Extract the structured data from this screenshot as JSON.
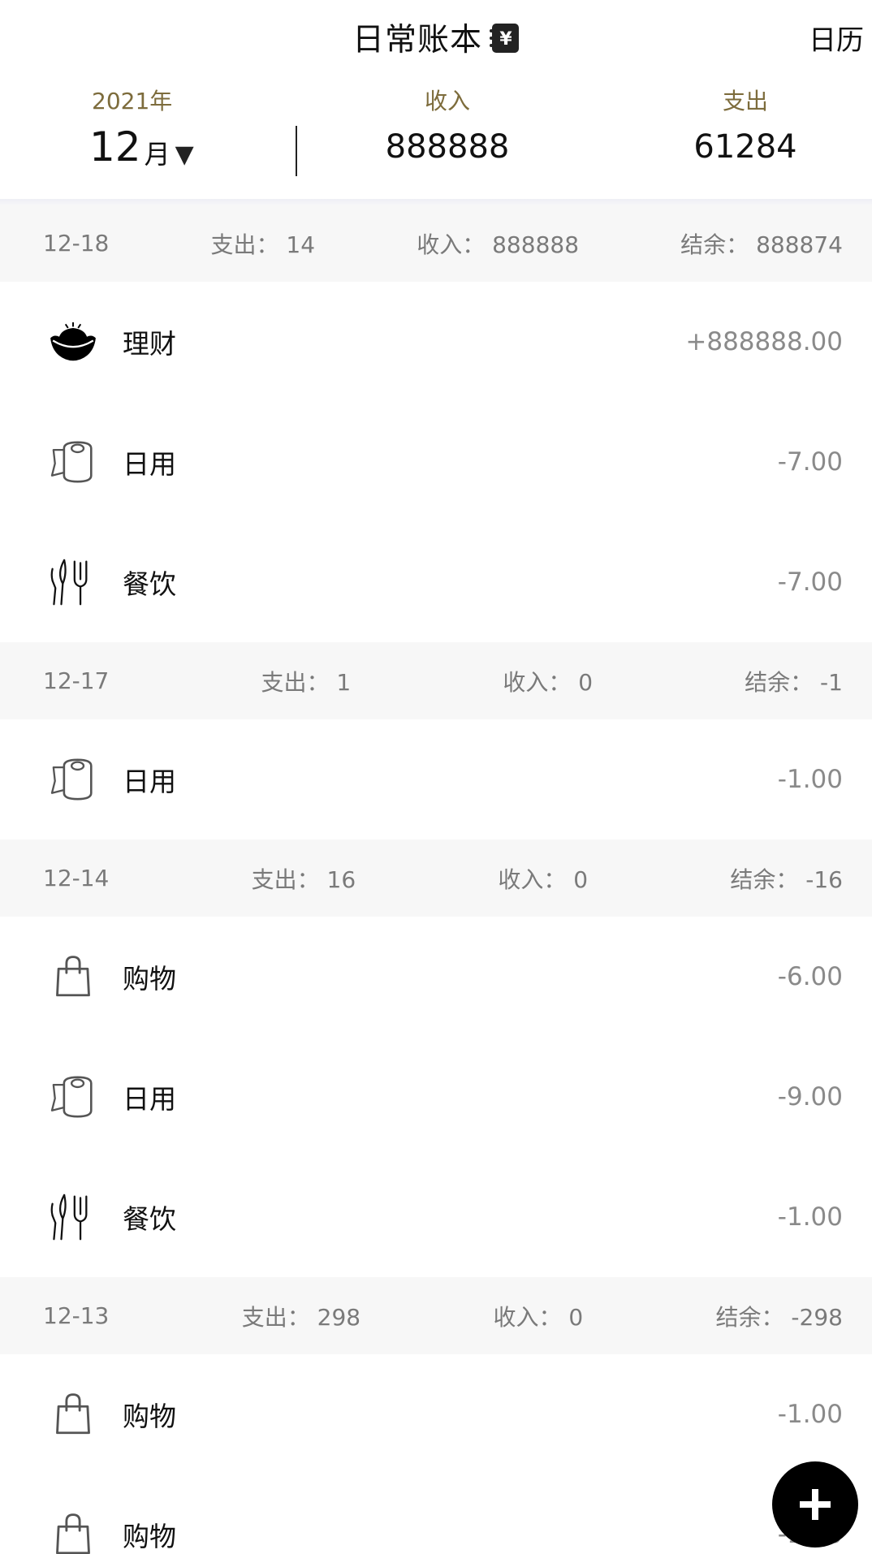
{
  "header": {
    "title": "日常账本",
    "title_icon": "yen-notebook-icon",
    "calendar_label": "日历"
  },
  "summary": {
    "year_label": "2021年",
    "month_value": "12",
    "month_unit": "月",
    "month_caret": "▼",
    "income_label": "收入",
    "income_value": "888888",
    "expense_label": "支出",
    "expense_value": "61284"
  },
  "colors": {
    "accent_gold": "#7d6c3c",
    "day_header_bg": "#f7f7f7",
    "amount_gray": "#8a8a8a",
    "fab": "#000000"
  },
  "days": [
    {
      "date": "12-18",
      "expense": "支出： 14",
      "income": "收入： 888888",
      "balance": "结余： 888874",
      "items": [
        {
          "category": "理财",
          "icon": "gold-ingot-icon",
          "amount": "+888888.00"
        },
        {
          "category": "日用",
          "icon": "toilet-paper-icon",
          "amount": "-7.00"
        },
        {
          "category": "餐饮",
          "icon": "cutlery-icon",
          "amount": "-7.00"
        }
      ]
    },
    {
      "date": "12-17",
      "expense": "支出： 1",
      "income": "收入： 0",
      "balance": "结余： -1",
      "items": [
        {
          "category": "日用",
          "icon": "toilet-paper-icon",
          "amount": "-1.00"
        }
      ]
    },
    {
      "date": "12-14",
      "expense": "支出： 16",
      "income": "收入： 0",
      "balance": "结余： -16",
      "items": [
        {
          "category": "购物",
          "icon": "shopping-bag-icon",
          "amount": "-6.00"
        },
        {
          "category": "日用",
          "icon": "toilet-paper-icon",
          "amount": "-9.00"
        },
        {
          "category": "餐饮",
          "icon": "cutlery-icon",
          "amount": "-1.00"
        }
      ]
    },
    {
      "date": "12-13",
      "expense": "支出： 298",
      "income": "收入： 0",
      "balance": "结余： -298",
      "items": [
        {
          "category": "购物",
          "icon": "shopping-bag-icon",
          "amount": "-1.00"
        },
        {
          "category": "购物",
          "icon": "shopping-bag-icon",
          "amount": "-1.00"
        }
      ]
    }
  ],
  "fab": {
    "label": "+",
    "icon": "plus-icon"
  }
}
